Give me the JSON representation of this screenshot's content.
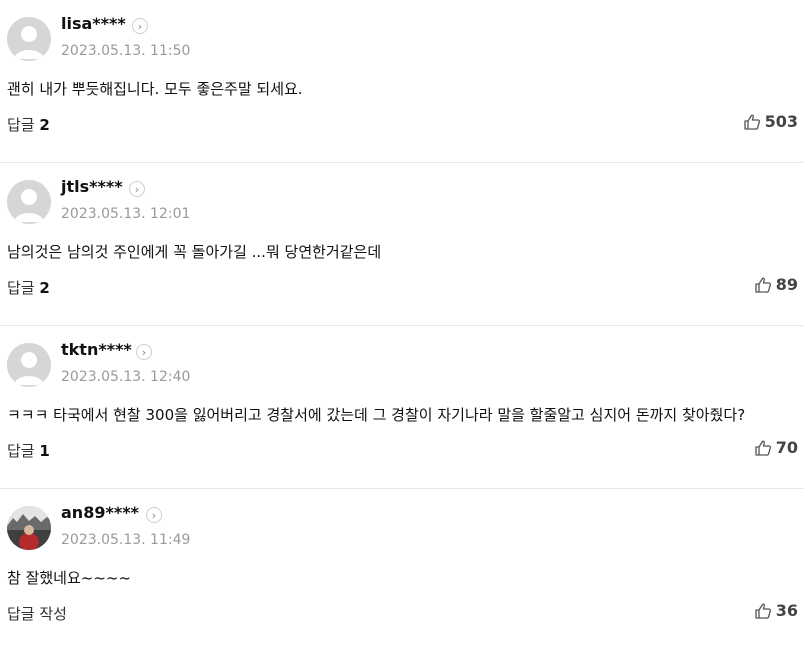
{
  "comments": [
    {
      "nickname": "lisa****",
      "date": "2023.05.13. 11:50",
      "text": "괜히 내가 뿌듯해집니다. 모두 좋은주말 되세요.",
      "reply_label": "답글",
      "reply_count": "2",
      "likes": "503",
      "avatar": "default-avatar"
    },
    {
      "nickname": "jtls****",
      "date": "2023.05.13. 12:01",
      "text": "남의것은 남의것 주인에게 꼭 돌아가길 ...뭐 당연한거같은데",
      "reply_label": "답글",
      "reply_count": "2",
      "likes": "89",
      "avatar": "default-avatar"
    },
    {
      "nickname": "tktn****",
      "date": "2023.05.13. 12:40",
      "text": "ㅋㅋㅋ 타국에서 현찰 300을 잃어버리고 경찰서에 갔는데 그 경찰이 자기나라 말을 할줄알고 심지어 돈까지 찾아줬다?",
      "reply_label": "답글",
      "reply_count": "1",
      "likes": "70",
      "avatar": "default-avatar"
    },
    {
      "nickname": "an89****",
      "date": "2023.05.13. 11:49",
      "text": "참 잘했네요~~~~",
      "reply_label": "답글 작성",
      "reply_count": "",
      "likes": "36",
      "avatar": "photo-avatar"
    }
  ],
  "icons": {
    "chevron": "chevron-right-icon",
    "like": "thumbs-up-icon"
  }
}
